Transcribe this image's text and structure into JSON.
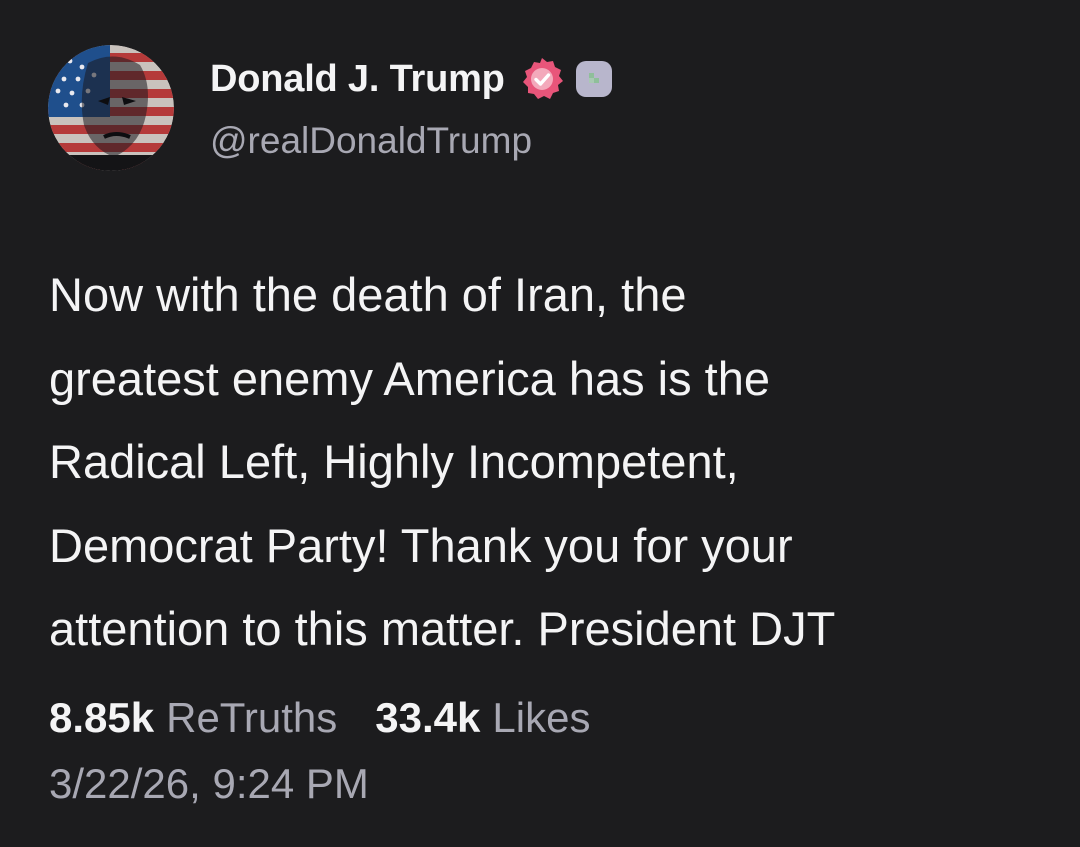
{
  "author": {
    "display_name": "Donald J. Trump",
    "handle": "@realDonaldTrump",
    "avatar_icon": "flag-portrait-avatar",
    "verified_icon": "verified-check-icon",
    "badge_icon": "account-badge-icon"
  },
  "post": {
    "lines": [
      "Now with the death of Iran, the",
      "greatest enemy America has is the",
      "Radical Left, Highly Incompetent,",
      "Democrat Party! Thank you for your",
      "attention to this matter. President DJT"
    ]
  },
  "stats": {
    "retruths_count": "8.85k",
    "retruths_label": "ReTruths",
    "likes_count": "33.4k",
    "likes_label": "Likes"
  },
  "timestamp": "3/22/26, 9:24 PM",
  "colors": {
    "background": "#1c1c1e",
    "primary_text": "#f4f4f5",
    "secondary_text": "#a8a8b3",
    "verified_pink": "#e8557a",
    "badge_gray": "#b8b6cc"
  }
}
